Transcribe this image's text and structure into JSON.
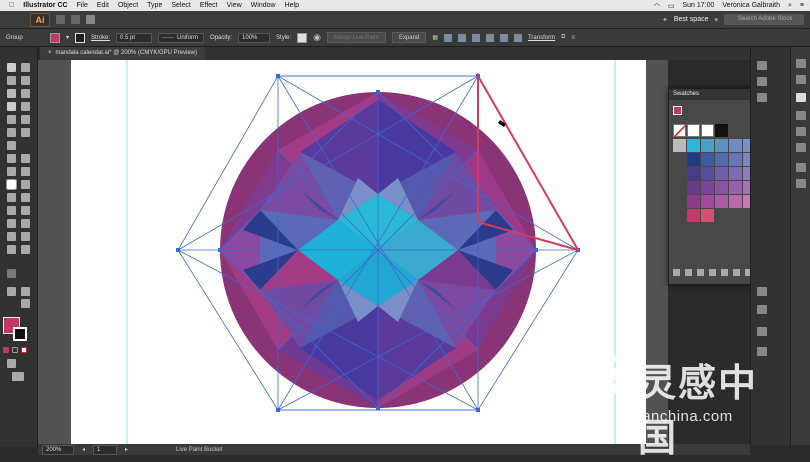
{
  "mac_menu": {
    "app": "Illustrator CC",
    "items": [
      "File",
      "Edit",
      "Object",
      "Type",
      "Select",
      "Effect",
      "View",
      "Window",
      "Help"
    ],
    "clock": "Sun 17:00",
    "user": "Veronica Galbraith"
  },
  "appbar": {
    "logo": "Ai",
    "workspace": "Best space",
    "search_placeholder": "Search Adobe Stock"
  },
  "control": {
    "selection": "Group",
    "stroke_label": "Stroke:",
    "stroke_value": "0.5 pt",
    "profile_value": "Uniform",
    "opacity_label": "Opacity:",
    "opacity_value": "100%",
    "style_label": "Style:",
    "merge_label": "Merge Live Paint",
    "expand_label": "Expand",
    "transform_label": "Transform",
    "fill_color": "#c23a64"
  },
  "document_tab": {
    "title": "mandala calendar.ai* @ 200% (CMYK/GPU Preview)",
    "close": "×"
  },
  "swatches_panel": {
    "title": "Swatches",
    "menu_glyph": "≡",
    "grid": [
      [
        "#2bb7d6",
        "#4a9fc8",
        "#5d8fc0",
        "#6c8cc4",
        "#7b8ec7",
        "#8d8fc6"
      ],
      [
        "#1d3d8a",
        "#3d5aa8",
        "#5169b1",
        "#6477b8",
        "#7886bf",
        "#8a93c4"
      ],
      [
        "#4a3a8a",
        "#5b4b9c",
        "#6d5daa",
        "#7d6cb4",
        "#8e7dbc",
        "#9c8dc4"
      ],
      [
        "#6a3a8c",
        "#7a449a",
        "#8a52a5",
        "#9762ad",
        "#a373b5",
        "#b084bd"
      ],
      [
        "#8c3a8a",
        "#a0489a",
        "#ad5aa5",
        "#b86aad",
        "#c27cb6",
        "#c94a7a"
      ],
      [
        "#c23a64",
        "#d3506f"
      ]
    ]
  },
  "statusbar": {
    "zoom": "200%",
    "artboard": "1",
    "tool": "Live Paint Bucket"
  },
  "watermark": {
    "brand_cn": "灵感中国",
    "url": "lingganchina.com"
  },
  "colors": {
    "accent": "#c23a64",
    "guide_cyan": "#5fe3e8",
    "selection_blue": "#3a6ad0"
  }
}
